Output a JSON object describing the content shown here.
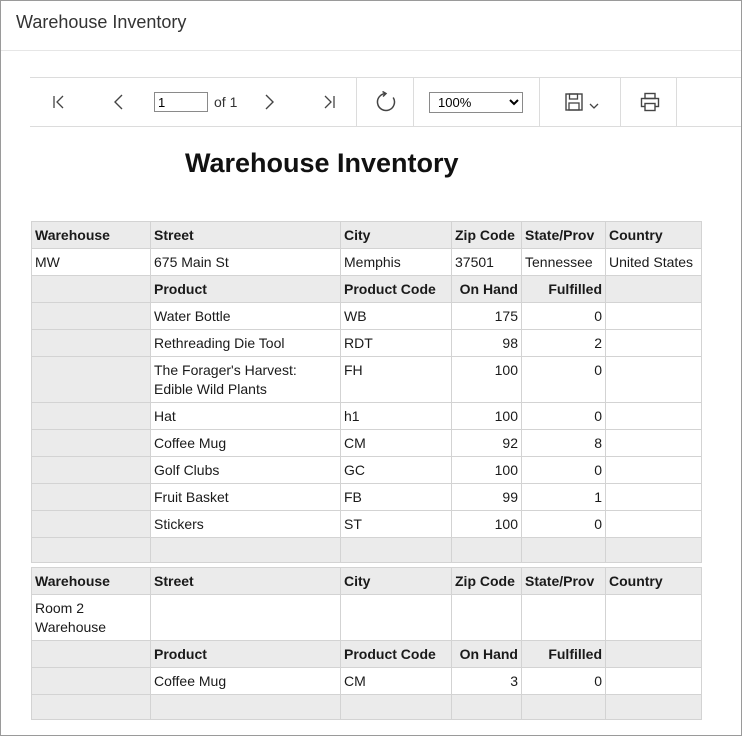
{
  "window": {
    "title": "Warehouse Inventory"
  },
  "toolbar": {
    "first_icon": "first-page-icon",
    "prev_icon": "previous-page-icon",
    "page_value": "1",
    "page_total": "of 1",
    "next_icon": "next-page-icon",
    "last_icon": "last-page-icon",
    "refresh_icon": "refresh-icon",
    "zoom_value": "100%",
    "zoom_options": [
      "100%"
    ],
    "save_icon": "save-icon",
    "dropdown_icon": "chevron-down-icon",
    "print_icon": "print-icon"
  },
  "report": {
    "title": "Warehouse Inventory",
    "warehouse_headers": [
      "Warehouse",
      "Street",
      "City",
      "Zip Code",
      "State/Prov",
      "Country"
    ],
    "product_headers": [
      "Product",
      "Product Code",
      "On Hand",
      "Fulfilled"
    ],
    "warehouses": [
      {
        "name": "MW",
        "street": "675 Main St",
        "city": "Memphis",
        "zip": "37501",
        "state": "Tennessee",
        "country": "United States",
        "products": [
          {
            "product": "Water Bottle",
            "code": "WB",
            "on_hand": "175",
            "fulfilled": "0"
          },
          {
            "product": "Rethreading Die Tool",
            "code": "RDT",
            "on_hand": "98",
            "fulfilled": "2"
          },
          {
            "product": "The Forager's Harvest: Edible Wild Plants",
            "code": "FH",
            "on_hand": "100",
            "fulfilled": "0"
          },
          {
            "product": "Hat",
            "code": "h1",
            "on_hand": "100",
            "fulfilled": "0"
          },
          {
            "product": "Coffee Mug",
            "code": "CM",
            "on_hand": "92",
            "fulfilled": "8"
          },
          {
            "product": "Golf Clubs",
            "code": "GC",
            "on_hand": "100",
            "fulfilled": "0"
          },
          {
            "product": "Fruit Basket",
            "code": "FB",
            "on_hand": "99",
            "fulfilled": "1"
          },
          {
            "product": "Stickers",
            "code": "ST",
            "on_hand": "100",
            "fulfilled": "0"
          }
        ]
      },
      {
        "name": "Room 2 Warehouse",
        "street": "",
        "city": "",
        "zip": "",
        "state": "",
        "country": "",
        "products": [
          {
            "product": "Coffee Mug",
            "code": "CM",
            "on_hand": "3",
            "fulfilled": "0"
          }
        ]
      }
    ]
  }
}
